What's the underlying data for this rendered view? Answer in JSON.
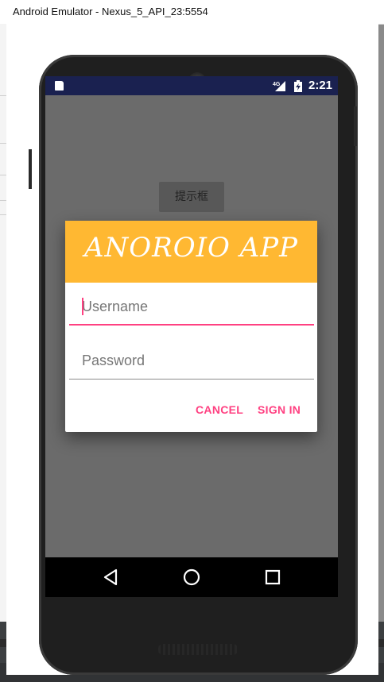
{
  "window": {
    "title": "Android Emulator - Nexus_5_API_23:5554"
  },
  "statusbar": {
    "network": "4G",
    "time": "2:21"
  },
  "screen": {
    "background_button_label": "提示框"
  },
  "dialog": {
    "brand": "ANOROIO APP",
    "username_placeholder": "Username",
    "password_placeholder": "Password",
    "cancel_label": "CANCEL",
    "signin_label": "SIGN IN"
  },
  "navbar": {
    "back_icon": "back-triangle-icon",
    "home_icon": "home-circle-icon",
    "recents_icon": "recents-square-icon"
  },
  "colors": {
    "header": "#ffb832",
    "accent": "#ff4081",
    "statusbar": "#1a2150"
  }
}
